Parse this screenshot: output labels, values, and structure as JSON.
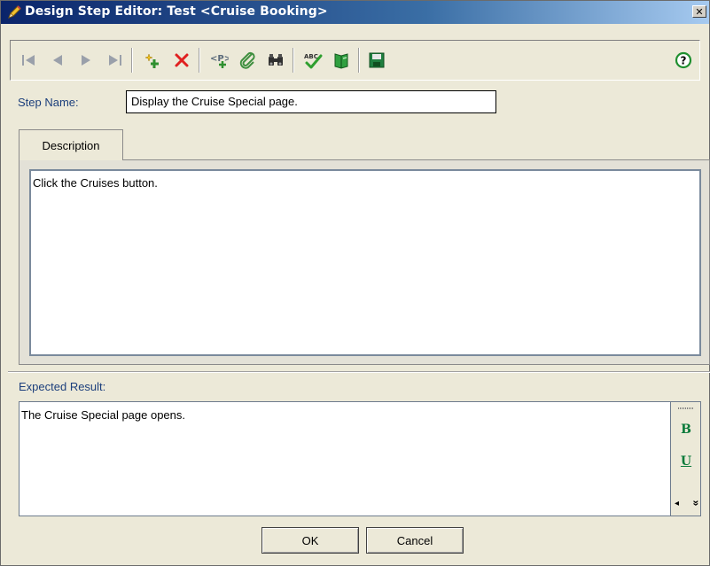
{
  "window": {
    "title": "Design Step Editor: Test <Cruise Booking>",
    "close_glyph": "✕"
  },
  "toolbar": {
    "buttons": [
      {
        "name": "first-record",
        "icon": "first-icon"
      },
      {
        "name": "previous-record",
        "icon": "previous-icon"
      },
      {
        "name": "next-record",
        "icon": "next-icon"
      },
      {
        "name": "last-record",
        "icon": "last-icon"
      },
      {
        "name": "new-step",
        "icon": "new-step-icon"
      },
      {
        "name": "delete-step",
        "icon": "delete-icon"
      },
      {
        "name": "insert-parameter",
        "icon": "insert-parameter-icon"
      },
      {
        "name": "attachments",
        "icon": "paperclip-icon"
      },
      {
        "name": "find",
        "icon": "binoculars-icon"
      },
      {
        "name": "check-spelling",
        "icon": "spell-check-icon"
      },
      {
        "name": "thesaurus",
        "icon": "book-icon"
      },
      {
        "name": "save",
        "icon": "floppy-disk-icon"
      },
      {
        "name": "help",
        "icon": "help-icon"
      }
    ]
  },
  "step_name": {
    "label": "Step Name:",
    "value": "Display the Cruise Special page."
  },
  "tabs": {
    "description_label": "Description"
  },
  "description": {
    "text": "Click the Cruises button."
  },
  "expected_result": {
    "label": "Expected Result:",
    "text": "The Cruise Special page opens."
  },
  "format_bar": {
    "bold": "B",
    "underline": "U",
    "more_left": "◂",
    "more_down": "»"
  },
  "buttons": {
    "ok": "OK",
    "cancel": "Cancel"
  },
  "colors": {
    "title_bar": "#0a246a",
    "label_text": "#1c3f7c",
    "delete_red": "#e02020",
    "format_green": "#0a7a3a"
  }
}
